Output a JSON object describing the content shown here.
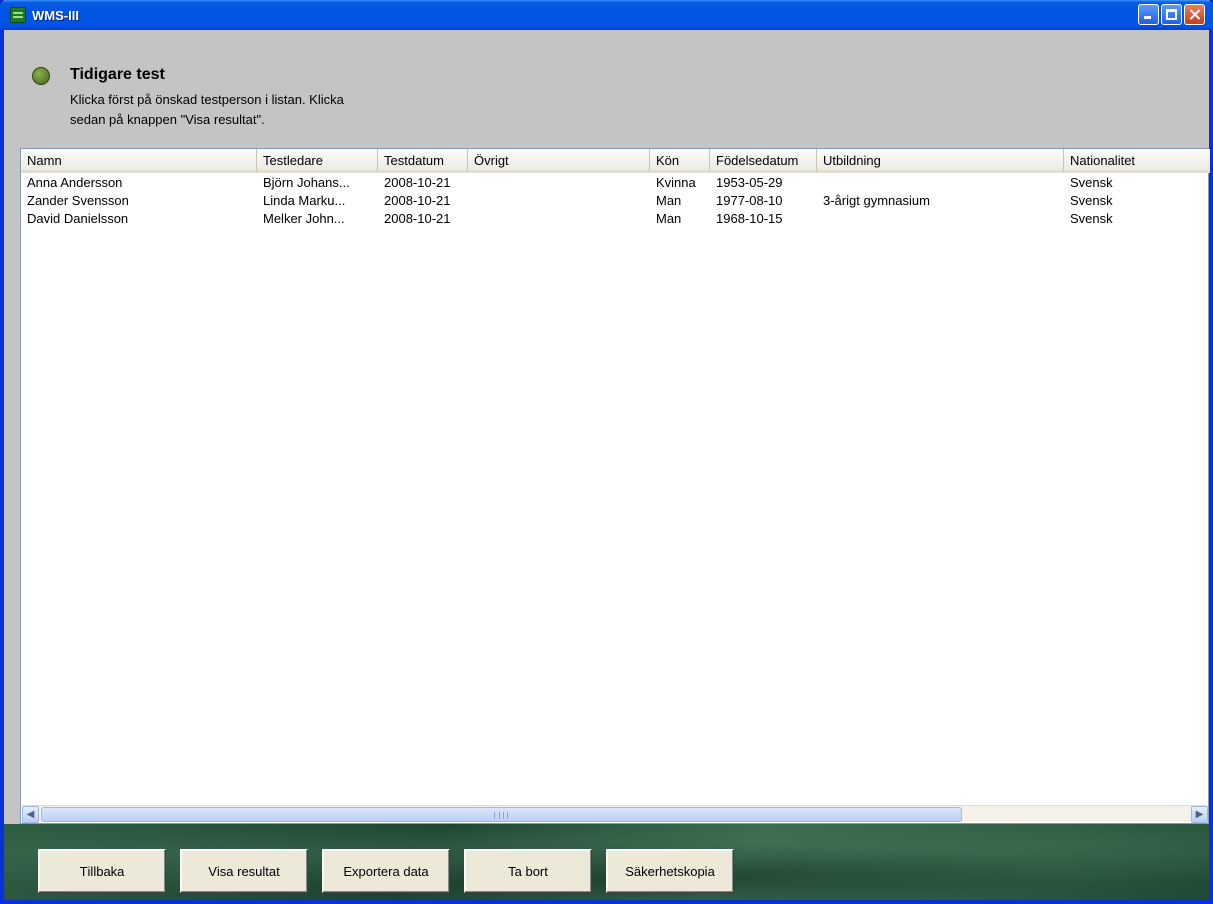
{
  "window": {
    "title": "WMS-III"
  },
  "header": {
    "title": "Tidigare test",
    "instructions_line1": "Klicka först på önskad testperson i listan. Klicka",
    "instructions_line2": "sedan på knappen \"Visa resultat\".",
    "status_color": "#587a2a"
  },
  "list": {
    "columns": [
      "Namn",
      "Testledare",
      "Testdatum",
      "Övrigt",
      "Kön",
      "Födelsedatum",
      "Utbildning",
      "Nationalitet"
    ],
    "rows": [
      [
        "Anna Andersson",
        "Björn Johans...",
        "2008-10-21",
        "",
        "Kvinna",
        "1953-05-29",
        "",
        "Svensk"
      ],
      [
        "Zander Svensson",
        "Linda Marku...",
        "2008-10-21",
        "",
        "Man",
        "1977-08-10",
        "3-årigt gymnasium",
        "Svensk"
      ],
      [
        "David Danielsson",
        "Melker John...",
        "2008-10-21",
        "",
        "Man",
        "1968-10-15",
        "",
        "Svensk"
      ]
    ]
  },
  "buttons": {
    "back": {
      "pre": "",
      "u": "T",
      "post": "illbaka"
    },
    "show_results": {
      "pre": "",
      "u": "V",
      "post": "isa resultat"
    },
    "export": {
      "pre": "",
      "u": "E",
      "post": "xportera data"
    },
    "delete": {
      "pre": "Ta b",
      "u": "o",
      "post": "rt"
    },
    "backup": {
      "pre": "",
      "u": "S",
      "post": "äkerhetskopia"
    }
  },
  "icons": {
    "app": "wms-app-icon",
    "minimize": "minimize-icon",
    "maximize": "maximize-icon",
    "close": "close-icon",
    "scroll_left": "arrow-left-icon",
    "scroll_right": "arrow-right-icon"
  }
}
